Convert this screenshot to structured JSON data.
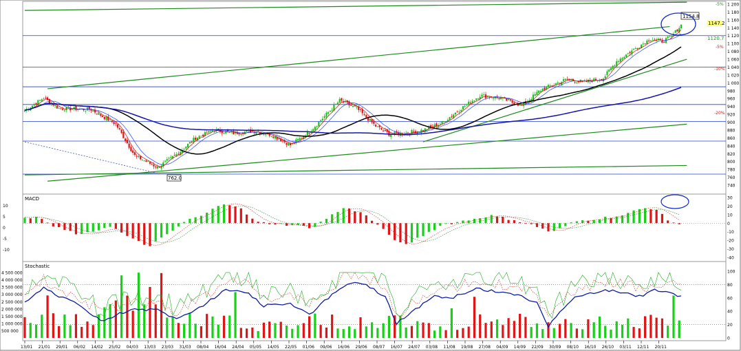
{
  "chart_data": [
    {
      "type": "candlestick",
      "panel": "price",
      "ylim": [
        740,
        1200
      ],
      "y_ticks": [
        740,
        760,
        780,
        800,
        820,
        840,
        860,
        880,
        900,
        920,
        940,
        960,
        980,
        1000,
        1020,
        1040,
        1060,
        1080,
        1100,
        1120,
        1140,
        1160,
        1180,
        1200
      ],
      "x_ticks": [
        "13/01",
        "21/01",
        "29/01",
        "06/02",
        "14/02",
        "25/02",
        "04/03",
        "13/03",
        "23/03",
        "31/03",
        "08/04",
        "16/04",
        "24/04",
        "05/05",
        "14/05",
        "22/05",
        "01/06",
        "09/06",
        "16/06",
        "29/06",
        "08/07",
        "16/07",
        "24/07",
        "03/08",
        "11/08",
        "19/08",
        "27/08",
        "04/09",
        "14/09",
        "22/09",
        "30/09",
        "08/10",
        "16/10",
        "26/10",
        "03/11",
        "12/11",
        "20/11"
      ],
      "close_keypoints": [
        [
          0,
          930
        ],
        [
          10,
          962
        ],
        [
          18,
          935
        ],
        [
          35,
          932
        ],
        [
          48,
          895
        ],
        [
          58,
          815
        ],
        [
          70,
          785
        ],
        [
          80,
          818
        ],
        [
          90,
          860
        ],
        [
          100,
          880
        ],
        [
          110,
          872
        ],
        [
          120,
          878
        ],
        [
          130,
          868
        ],
        [
          140,
          842
        ],
        [
          150,
          875
        ],
        [
          160,
          925
        ],
        [
          166,
          955
        ],
        [
          175,
          935
        ],
        [
          185,
          890
        ],
        [
          192,
          870
        ],
        [
          200,
          872
        ],
        [
          210,
          880
        ],
        [
          220,
          898
        ],
        [
          230,
          935
        ],
        [
          240,
          968
        ],
        [
          250,
          962
        ],
        [
          262,
          942
        ],
        [
          272,
          982
        ],
        [
          285,
          1008
        ],
        [
          295,
          1002
        ],
        [
          305,
          1012
        ],
        [
          312,
          1055
        ],
        [
          322,
          1088
        ],
        [
          330,
          1112
        ],
        [
          336,
          1105
        ],
        [
          341,
          1118
        ],
        [
          346,
          1147
        ]
      ],
      "candle_count": 347,
      "value_labels": {
        "top_marker": "1154.8",
        "last_price": "1147.2",
        "pivot": "1120.7",
        "low_marker": "762.0"
      },
      "retracement_labels": [
        "-5%",
        "-10%",
        "-20%"
      ],
      "top_right_label": "-5%",
      "ma_fast_color": "#e00000",
      "ma_mid_color": "#2040ff",
      "ma_slow_color": "#000000",
      "ma_long_color": "#1414aa",
      "horizontal_levels": [
        1120,
        1040,
        990,
        945,
        902,
        852,
        768
      ],
      "trendlines_note": "green channel lines"
    },
    {
      "type": "bar",
      "panel": "macd",
      "title": "MACD",
      "ylim": [
        -40,
        30
      ],
      "right_ticks": [
        30,
        20,
        10,
        0,
        -10,
        -20,
        -30,
        -40
      ],
      "left_ticks": [
        10,
        5,
        0,
        -5,
        -10
      ],
      "hist_keypoints": [
        [
          0,
          5
        ],
        [
          8,
          7
        ],
        [
          15,
          -4
        ],
        [
          30,
          -14
        ],
        [
          45,
          -3
        ],
        [
          56,
          -18
        ],
        [
          65,
          -27
        ],
        [
          75,
          -14
        ],
        [
          85,
          3
        ],
        [
          95,
          10
        ],
        [
          104,
          24
        ],
        [
          112,
          20
        ],
        [
          122,
          1
        ],
        [
          140,
          -2
        ],
        [
          152,
          -5
        ],
        [
          162,
          10
        ],
        [
          170,
          19
        ],
        [
          180,
          9
        ],
        [
          190,
          -10
        ],
        [
          200,
          -27
        ],
        [
          210,
          -14
        ],
        [
          220,
          -2
        ],
        [
          232,
          3
        ],
        [
          245,
          9
        ],
        [
          258,
          4
        ],
        [
          270,
          -4
        ],
        [
          278,
          -11
        ],
        [
          290,
          2
        ],
        [
          300,
          5
        ],
        [
          315,
          9
        ],
        [
          325,
          17
        ],
        [
          332,
          18
        ],
        [
          338,
          5
        ],
        [
          344,
          -1
        ]
      ],
      "up_color": "#18d018",
      "down_color": "#e01414"
    },
    {
      "type": "bar",
      "panel": "volume_stochastic",
      "title": "Stochastic",
      "volume_ticks": [
        "4 500 000",
        "4 000 000",
        "3 500 000",
        "3 000 000",
        "2 500 000",
        "2 000 000",
        "1 500 000",
        "1 000 000",
        "500 000"
      ],
      "stoch_ticks": [
        100,
        80,
        60,
        40,
        20,
        0
      ],
      "stoch_keypoints": [
        [
          0,
          52
        ],
        [
          10,
          75
        ],
        [
          20,
          60
        ],
        [
          30,
          48
        ],
        [
          40,
          25
        ],
        [
          55,
          42
        ],
        [
          70,
          42
        ],
        [
          80,
          28
        ],
        [
          95,
          50
        ],
        [
          105,
          72
        ],
        [
          118,
          68
        ],
        [
          125,
          48
        ],
        [
          140,
          52
        ],
        [
          150,
          35
        ],
        [
          160,
          60
        ],
        [
          170,
          82
        ],
        [
          180,
          80
        ],
        [
          190,
          62
        ],
        [
          196,
          22
        ],
        [
          205,
          40
        ],
        [
          215,
          62
        ],
        [
          225,
          60
        ],
        [
          238,
          74
        ],
        [
          252,
          68
        ],
        [
          262,
          62
        ],
        [
          270,
          52
        ],
        [
          276,
          18
        ],
        [
          282,
          40
        ],
        [
          290,
          60
        ],
        [
          305,
          72
        ],
        [
          315,
          68
        ],
        [
          325,
          62
        ],
        [
          332,
          72
        ],
        [
          340,
          70
        ],
        [
          345,
          58
        ],
        [
          349,
          70
        ]
      ],
      "volume_keypoints": [
        [
          0,
          1100000
        ],
        [
          20,
          1400000
        ],
        [
          40,
          1200000
        ],
        [
          55,
          4000000
        ],
        [
          60,
          2500000
        ],
        [
          70,
          3000000
        ],
        [
          80,
          1800000
        ],
        [
          100,
          1300000
        ],
        [
          120,
          900000
        ],
        [
          140,
          1100000
        ],
        [
          160,
          1300000
        ],
        [
          180,
          1000000
        ],
        [
          200,
          1400000
        ],
        [
          220,
          900000
        ],
        [
          240,
          1200000
        ],
        [
          260,
          1000000
        ],
        [
          280,
          1300000
        ],
        [
          300,
          1100000
        ],
        [
          320,
          1200000
        ],
        [
          340,
          1100000
        ]
      ],
      "stoch_color": "#0a1aa8"
    }
  ]
}
